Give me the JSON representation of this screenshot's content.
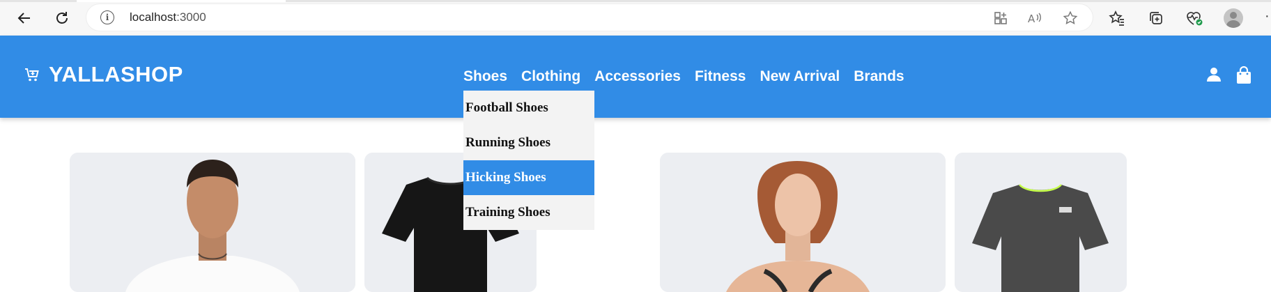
{
  "browser": {
    "url_host": "localhost",
    "url_port": ":3000",
    "icons": {
      "back": "back-arrow-icon",
      "reload": "reload-icon",
      "site_info": "info-icon",
      "app_available": "app-available-icon",
      "read_aloud": "read-aloud-icon",
      "favorite": "star-icon",
      "favorites": "favorites-icon",
      "collections": "collections-icon",
      "browser_essentials": "heart-pulse-icon",
      "profile": "profile-icon",
      "menu": "more-icon"
    }
  },
  "header": {
    "brand": "YALLASHOP",
    "brand_icon": "cart-icon",
    "nav": [
      "Shoes",
      "Clothing",
      "Accessories",
      "Fitness",
      "New Arrival",
      "Brands"
    ],
    "user_icon": "user-icon",
    "bag_icon": "shopping-bag-icon"
  },
  "dropdown": {
    "items": [
      "Football Shoes",
      "Running Shoes",
      "Hicking Shoes",
      "Training Shoes"
    ],
    "highlighted": "Hicking Shoes"
  },
  "colors": {
    "primary": "#318ce6",
    "dropdown_bg": "#f3f3f3",
    "card_bg": "#eceef2"
  },
  "products": {
    "images": [
      "man-white-tshirt-photo",
      "black-tshirt-photo",
      "woman-sports-bra-photo",
      "grey-tshirt-photo"
    ]
  }
}
